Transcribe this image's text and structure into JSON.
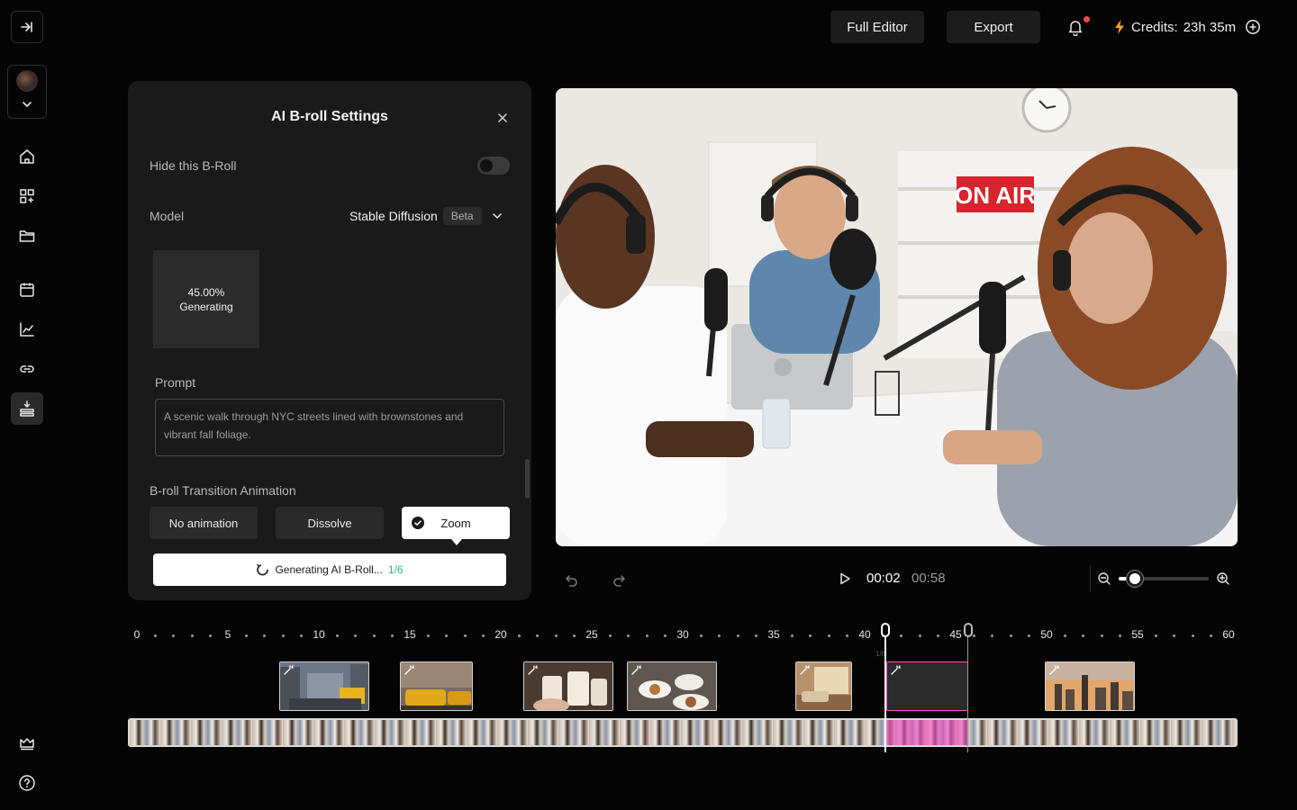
{
  "topbar": {
    "full_editor_label": "Full Editor",
    "export_label": "Export",
    "credits_label": "Credits:",
    "credits_value": "23h 35m"
  },
  "sidebar": {
    "items": [
      {
        "name": "home",
        "icon": "home-icon"
      },
      {
        "name": "templates",
        "icon": "grid-plus-icon"
      },
      {
        "name": "files",
        "icon": "folder-icon"
      },
      {
        "name": "calendar",
        "icon": "calendar-icon"
      },
      {
        "name": "analytics",
        "icon": "chart-line-icon"
      },
      {
        "name": "links",
        "icon": "link-icon"
      },
      {
        "name": "layers",
        "icon": "layers-icon",
        "active": true
      }
    ]
  },
  "panel": {
    "title": "AI B-roll Settings",
    "hide_label": "Hide this B-Roll",
    "hide_enabled": false,
    "model_label": "Model",
    "model_value": "Stable Diffusion",
    "model_badge": "Beta",
    "generation_percent": "45.00%",
    "generation_status": "Generating",
    "prompt_label": "Prompt",
    "prompt_text": "A scenic walk through NYC streets lined with brownstones and vibrant fall foliage.",
    "transition_label": "B-roll Transition Animation",
    "transitions": [
      "No animation",
      "Dissolve",
      "Zoom"
    ],
    "selected_transition": "Zoom",
    "generate_label": "Generating AI B-Roll...",
    "generate_progress": "1/6"
  },
  "video": {
    "sign_text": "ON AIR"
  },
  "player": {
    "current_time": "00:02",
    "total_time": "00:58",
    "zoom_level": 0.18
  },
  "timeline": {
    "ticks": [
      "0",
      "5",
      "10",
      "15",
      "20",
      "25",
      "30",
      "35",
      "40",
      "45",
      "50",
      "55",
      "60"
    ],
    "clip_fraction": "1/6",
    "clips": [
      {
        "name": "nyc-street",
        "theme": "city"
      },
      {
        "name": "taxi",
        "theme": "taxi"
      },
      {
        "name": "coffee-cups",
        "theme": "coffee"
      },
      {
        "name": "brunch-table",
        "theme": "food"
      },
      {
        "name": "cozy-room",
        "theme": "room"
      },
      {
        "name": "generating",
        "theme": "empty"
      },
      {
        "name": "skyline",
        "theme": "skyline"
      }
    ]
  },
  "colors": {
    "accent_pink": "#ff4fc4",
    "progress_green": "#2fb67c",
    "notification_red": "#f04848",
    "credits_bolt": "#f5a623"
  }
}
